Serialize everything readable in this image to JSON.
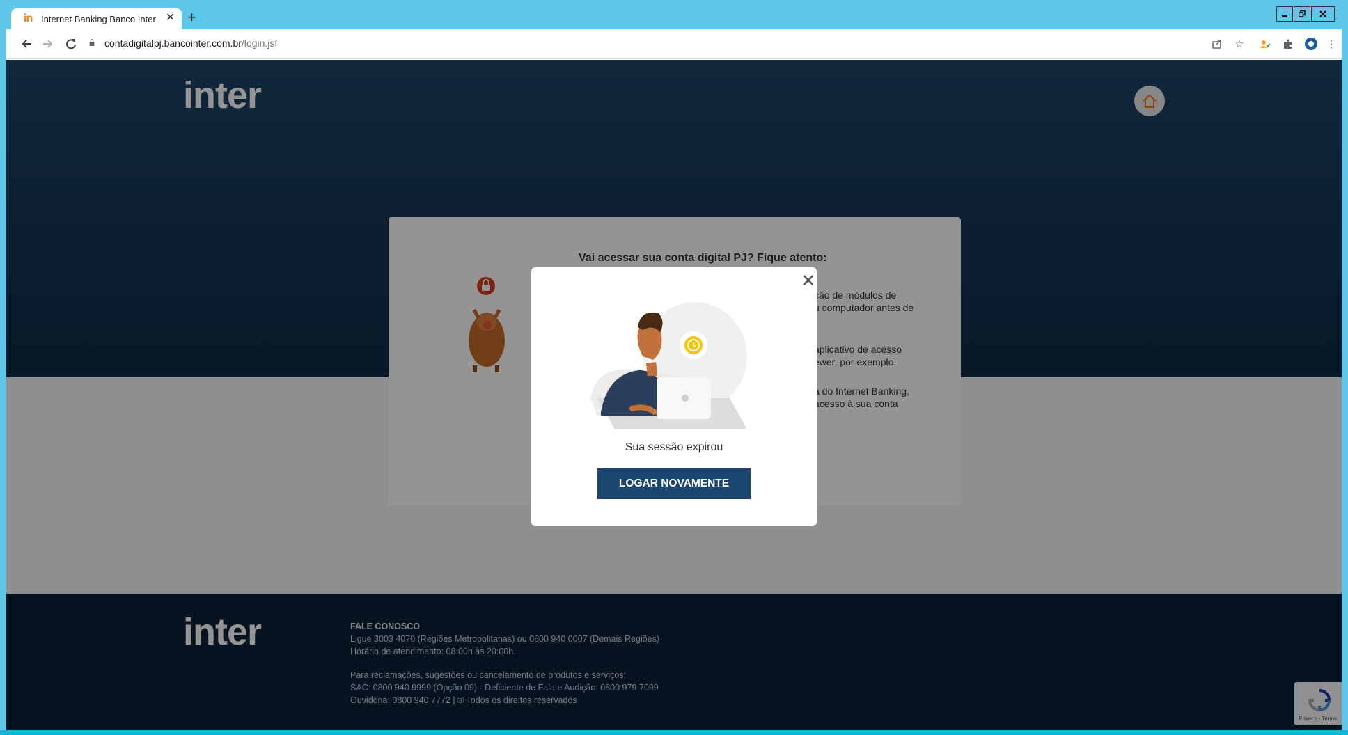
{
  "browser": {
    "tab_title": "Internet Banking Banco Inter",
    "tab_favicon": "in",
    "new_tab_symbol": "+",
    "url_domain": "contadigitalpj.bancointer.com.br",
    "url_path": "/login.jsf"
  },
  "page": {
    "logo_text": "inter",
    "footer_logo_text": "inter",
    "card": {
      "title": "Vai acessar sua conta digital PJ? Fique atento:",
      "line1a": "ção de módulos de",
      "line1b": "u computador antes de",
      "line2a": "aplicativo de acesso",
      "line2b": "ewer, por exemplo.",
      "line3a": "a do Internet Banking,",
      "line3b": "acesso à sua conta"
    },
    "footer": {
      "heading": "FALE CONOSCO",
      "line1": "Ligue 3003 4070 (Regiões Metropolitanas) ou 0800 940 0007 (Demais Regiões)",
      "line2": "Horário de atendimento: 08:00h às 20:00h.",
      "line3": "Para reclamações, sugestões ou cancelamento de produtos e serviços:",
      "line4": "SAC: 0800 940 9999 (Opção 09) - Deficiente de Fala e Audição: 0800 979 7099",
      "line5": "Ouvidoria: 0800 940 7772 | ® Todos os direitos reservados"
    },
    "recaptcha_links": "Privacy - Terms"
  },
  "modal": {
    "message": "Sua sessão expirou",
    "button_label": "LOGAR NOVAMENTE",
    "close_symbol": "✕"
  },
  "colors": {
    "brand_orange": "#ff7a00",
    "primary_button": "#1c4670",
    "hero_dark": "#143453",
    "footer_bg": "#0d2238"
  }
}
